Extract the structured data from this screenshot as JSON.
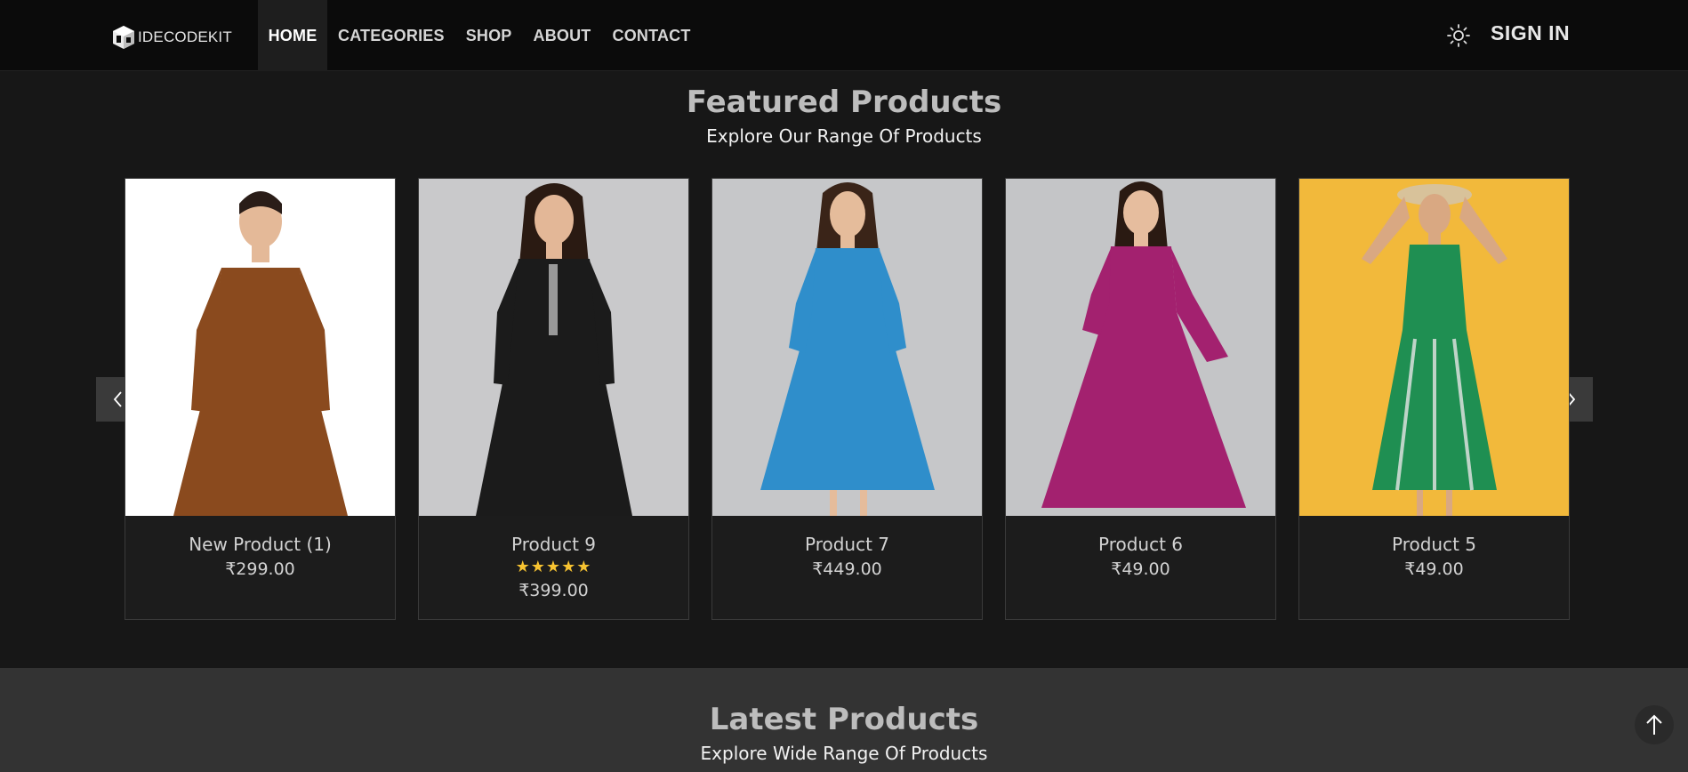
{
  "brand": {
    "logo_text": "IDECODEKIT"
  },
  "nav": {
    "items": [
      {
        "label": "HOME",
        "active": true
      },
      {
        "label": "CATEGORIES",
        "active": false
      },
      {
        "label": "SHOP",
        "active": false
      },
      {
        "label": "ABOUT",
        "active": false
      },
      {
        "label": "CONTACT",
        "active": false
      }
    ],
    "theme_icon": "sun-icon",
    "signin_label": "SIGN IN"
  },
  "featured": {
    "title": "Featured Products",
    "subtitle": "Explore Our Range Of Products",
    "products": [
      {
        "name": "New Product (1)",
        "price": "₹299.00",
        "rating": null,
        "stars_text": "",
        "image_bg": "#ffffff",
        "dress_color": "#8a4a1e"
      },
      {
        "name": "Product 9",
        "price": "₹399.00",
        "rating": 5,
        "stars_text": "★★★★★",
        "image_bg": "#c9c9cb",
        "dress_color": "#1b1b1b"
      },
      {
        "name": "Product 7",
        "price": "₹449.00",
        "rating": null,
        "stars_text": "",
        "image_bg": "#c6c7c9",
        "dress_color": "#2f8ecb"
      },
      {
        "name": "Product 6",
        "price": "₹49.00",
        "rating": null,
        "stars_text": "",
        "image_bg": "#c4c5c7",
        "dress_color": "#a3216f"
      },
      {
        "name": "Product 5",
        "price": "₹49.00",
        "rating": null,
        "stars_text": "",
        "image_bg": "#f2b93b",
        "dress_color": "#1f8f52"
      }
    ]
  },
  "latest": {
    "title": "Latest Products",
    "subtitle": "Explore Wide Range Of Products"
  },
  "icons": {
    "prev": "chevron-left-icon",
    "next": "chevron-right-icon",
    "scroll_top": "arrow-up-icon"
  },
  "colors": {
    "nav_bg": "#0b0b0b",
    "page_bg": "#171717",
    "latest_bg": "#333333",
    "star": "#f7c331"
  }
}
